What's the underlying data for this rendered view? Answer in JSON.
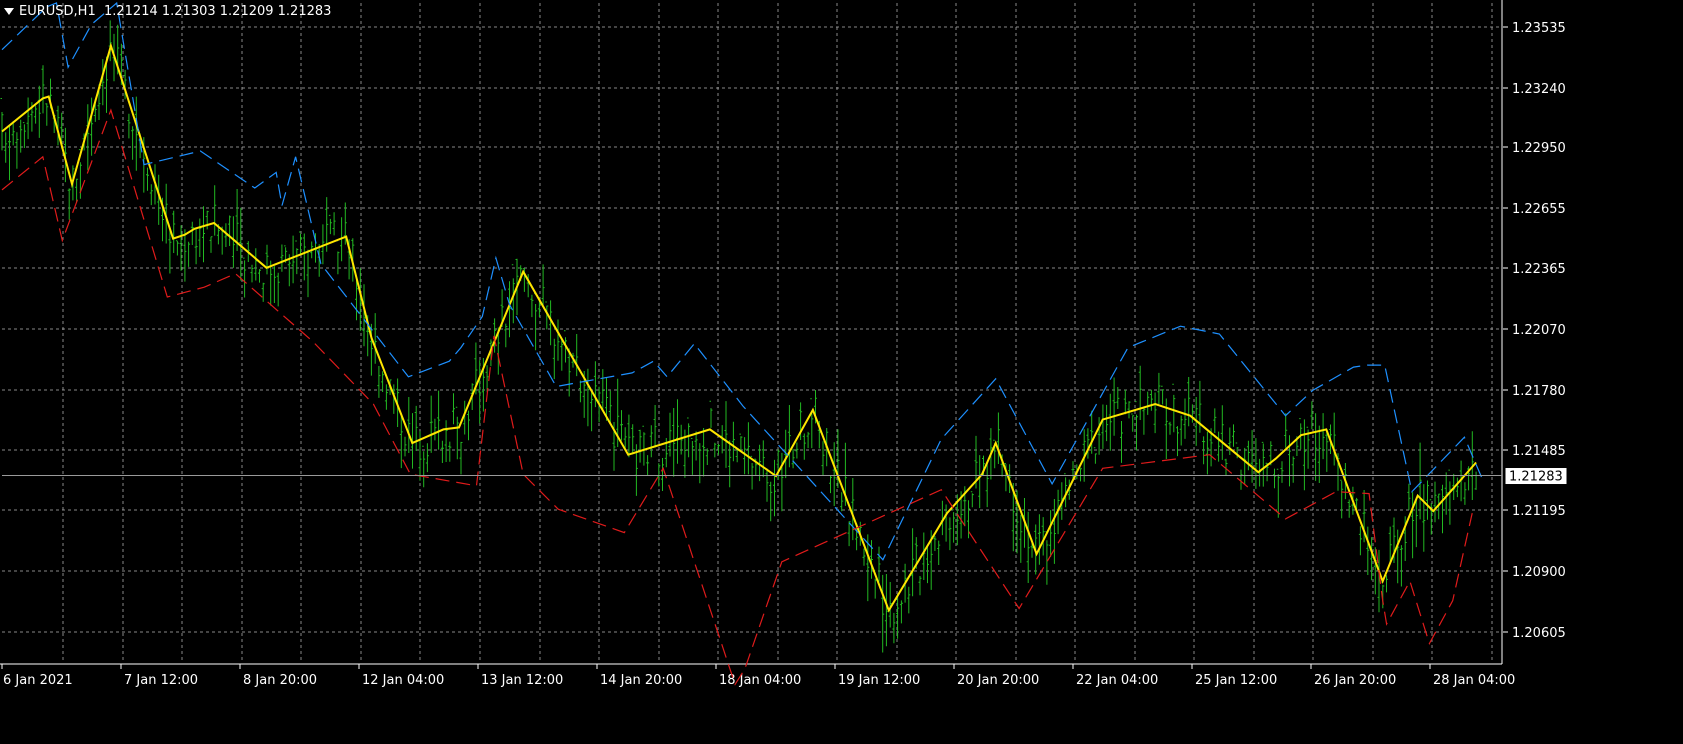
{
  "header": {
    "symbol": "EURUSD,H1",
    "ohlc": "1.21214 1.21303 1.21209 1.21283"
  },
  "current_price_label": "1.21283",
  "colors": {
    "background": "#000000",
    "grid": "#b4b4b4",
    "bars": "#22b822",
    "mid": "#ffe600",
    "upper": "#1e90ff",
    "lower": "#e01b1b",
    "axis": "#ffffff"
  },
  "chart_data": {
    "type": "line",
    "title": "EURUSD,H1",
    "xlabel": "",
    "ylabel": "",
    "ylim": [
      1.2032,
      1.2371
    ],
    "x_ticks": [
      "6 Jan 2021",
      "7 Jan 12:00",
      "8 Jan 20:00",
      "12 Jan 04:00",
      "13 Jan 12:00",
      "14 Jan 20:00",
      "18 Jan 04:00",
      "19 Jan 12:00",
      "20 Jan 20:00",
      "22 Jan 04:00",
      "25 Jan 12:00",
      "26 Jan 20:00",
      "28 Jan 04:00"
    ],
    "y_ticks": [
      "1.23535",
      "1.23240",
      "1.22950",
      "1.22655",
      "1.22365",
      "1.22070",
      "1.21780",
      "1.21485",
      "1.21195",
      "1.20900",
      "1.20605"
    ],
    "current_price": 1.21283,
    "grid": true,
    "series": [
      {
        "key": "mid",
        "style": "solid",
        "x": [
          0,
          2.1,
          2.4,
          3.6,
          5.6,
          8.8,
          9.4,
          9.9,
          10.9,
          13.6,
          17.7,
          19.0,
          21.1,
          22.7,
          23.5,
          26.8,
          32.2,
          36.4,
          39.8,
          41.7,
          45.6,
          48.6,
          50.4,
          51.1,
          53.2,
          56.6,
          59.3,
          61.1,
          64.6,
          65.5,
          66.8,
          68.1,
          71.0,
          72.8,
          73.6,
          75.8
        ],
        "y": [
          1.2305,
          1.2322,
          1.2323,
          1.2278,
          1.2349,
          1.225,
          1.2252,
          1.2255,
          1.2258,
          1.2235,
          1.2251,
          1.2199,
          1.2145,
          1.2152,
          1.2153,
          1.2233,
          1.2139,
          1.2152,
          1.2128,
          1.2162,
          1.2059,
          1.2109,
          1.2129,
          1.2145,
          1.2088,
          1.2157,
          1.2165,
          1.2159,
          1.213,
          1.2137,
          1.2149,
          1.2152,
          1.2074,
          1.2118,
          1.211,
          1.2135
        ]
      },
      {
        "key": "upper",
        "style": "dashed",
        "x": [
          0,
          2.3,
          2.8,
          3.4,
          4.6,
          5.9,
          7.3,
          10.2,
          13.0,
          14.1,
          14.4,
          15.1,
          16.4,
          20.9,
          23.0,
          23.6,
          24.7,
          25.4,
          26.1,
          28.5,
          32.4,
          33.5,
          34.2,
          35.6,
          38.1,
          45.3,
          48.3,
          51.1,
          54.0,
          57.9,
          60.6,
          62.6,
          66.0,
          67.4,
          69.5,
          70.2,
          71.1,
          72.5,
          75.2,
          76.1
        ],
        "y": [
          1.2347,
          1.2369,
          1.2371,
          1.2338,
          1.236,
          1.2371,
          1.2288,
          1.2295,
          1.2276,
          1.2284,
          1.2267,
          1.2292,
          1.2237,
          1.2179,
          1.2187,
          1.2194,
          1.221,
          1.224,
          1.2216,
          1.2174,
          1.2181,
          1.2187,
          1.2179,
          1.2196,
          1.2164,
          1.2085,
          1.2147,
          1.2178,
          1.2124,
          1.2194,
          1.2205,
          1.2201,
          1.2159,
          1.2172,
          1.2184,
          1.2185,
          1.2185,
          1.212,
          1.2148,
          1.2127
        ]
      },
      {
        "key": "lower",
        "style": "dashed",
        "x": [
          0,
          2.1,
          3.1,
          5.6,
          8.5,
          10.4,
          12.0,
          16.0,
          19.1,
          21.0,
          24.4,
          25.3,
          26.8,
          28.6,
          32.0,
          34.0,
          37.7,
          38.2,
          40.1,
          48.3,
          52.3,
          56.6,
          62.1,
          66.0,
          68.6,
          70.3,
          71.0,
          71.2,
          72.4,
          73.4,
          74.6,
          75.6
        ],
        "y": [
          1.2275,
          1.2292,
          1.2249,
          1.2316,
          1.222,
          1.2225,
          1.2232,
          1.2197,
          1.2165,
          1.2129,
          1.2123,
          1.22,
          1.2129,
          1.2111,
          1.2099,
          1.2132,
          1.2021,
          1.2029,
          1.2084,
          1.2121,
          1.206,
          1.2132,
          1.2139,
          1.2106,
          1.212,
          1.2119,
          1.2064,
          1.2052,
          1.2074,
          1.2042,
          1.2064,
          1.2109
        ]
      }
    ],
    "bars": {
      "interval_hours": 1,
      "count": 396,
      "note": "OHLC bars follow the mid line; last bar O/H/L/C from header",
      "last": {
        "open": 1.21214,
        "high": 1.21303,
        "low": 1.21209,
        "close": 1.21283
      }
    }
  }
}
